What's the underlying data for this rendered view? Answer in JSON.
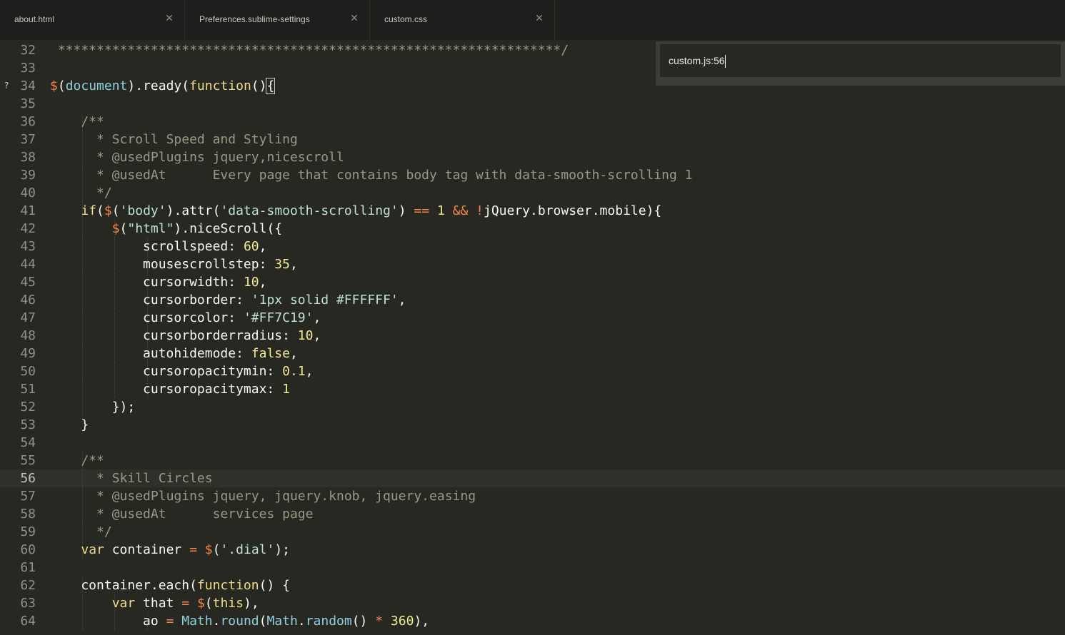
{
  "tabs": [
    {
      "label": "about.html"
    },
    {
      "label": "Preferences.sublime-settings"
    },
    {
      "label": "custom.css"
    }
  ],
  "goto": {
    "value": "custom.js:56"
  },
  "gutter_mark": "?",
  "lines": [
    {
      "n": "32",
      "guides": [],
      "tokens": [
        [
          "cm",
          " *****************************************************************/"
        ]
      ]
    },
    {
      "n": "33",
      "guides": [],
      "tokens": []
    },
    {
      "n": "34",
      "mark": true,
      "guides": [],
      "tokens": [
        [
          "dol",
          "$"
        ],
        [
          "plain",
          "("
        ],
        [
          "math",
          "document"
        ],
        [
          "plain",
          ").ready("
        ],
        [
          "kw",
          "function"
        ],
        [
          "plain",
          "()"
        ],
        [
          "brace",
          "{"
        ]
      ]
    },
    {
      "n": "35",
      "guides": [],
      "tokens": []
    },
    {
      "n": "36",
      "guides": [],
      "tokens": [
        [
          "plain",
          "    "
        ],
        [
          "cm",
          "/**"
        ]
      ]
    },
    {
      "n": "37",
      "guides": [],
      "tokens": [
        [
          "plain",
          "    "
        ],
        [
          "cm",
          "  * Scroll Speed and Styling"
        ]
      ]
    },
    {
      "n": "38",
      "guides": [],
      "tokens": [
        [
          "plain",
          "    "
        ],
        [
          "cm",
          "  * @usedPlugins jquery,nicescroll"
        ]
      ]
    },
    {
      "n": "39",
      "guides": [],
      "tokens": [
        [
          "plain",
          "    "
        ],
        [
          "cm",
          "  * @usedAt      Every page that contains body tag with data-smooth-scrolling 1"
        ]
      ]
    },
    {
      "n": "40",
      "guides": [],
      "tokens": [
        [
          "plain",
          "    "
        ],
        [
          "cm",
          "  */"
        ]
      ]
    },
    {
      "n": "41",
      "guides": [],
      "tokens": [
        [
          "plain",
          "    "
        ],
        [
          "kw",
          "if"
        ],
        [
          "plain",
          "("
        ],
        [
          "dol",
          "$"
        ],
        [
          "plain",
          "("
        ],
        [
          "str",
          "'body'"
        ],
        [
          "plain",
          ").attr("
        ],
        [
          "str",
          "'data-smooth-scrolling'"
        ],
        [
          "plain",
          ") "
        ],
        [
          "op",
          "=="
        ],
        [
          "plain",
          " "
        ],
        [
          "num",
          "1"
        ],
        [
          "plain",
          " "
        ],
        [
          "op",
          "&&"
        ],
        [
          "plain",
          " "
        ],
        [
          "op",
          "!"
        ],
        [
          "plain",
          "jQuery.browser.mobile){"
        ]
      ]
    },
    {
      "n": "42",
      "guides": [],
      "tokens": [
        [
          "plain",
          "        "
        ],
        [
          "dol",
          "$"
        ],
        [
          "plain",
          "("
        ],
        [
          "str",
          "\"html\""
        ],
        [
          "plain",
          ").niceScroll({"
        ]
      ]
    },
    {
      "n": "43",
      "guides": [],
      "tokens": [
        [
          "plain",
          "            scrollspeed: "
        ],
        [
          "num",
          "60"
        ],
        [
          "plain",
          ","
        ]
      ]
    },
    {
      "n": "44",
      "guides": [],
      "tokens": [
        [
          "plain",
          "            mousescrollstep: "
        ],
        [
          "num",
          "35"
        ],
        [
          "plain",
          ","
        ]
      ]
    },
    {
      "n": "45",
      "guides": [],
      "tokens": [
        [
          "plain",
          "            cursorwidth: "
        ],
        [
          "num",
          "10"
        ],
        [
          "plain",
          ","
        ]
      ]
    },
    {
      "n": "46",
      "guides": [],
      "tokens": [
        [
          "plain",
          "            cursorborder: "
        ],
        [
          "str",
          "'1px solid #FFFFFF'"
        ],
        [
          "plain",
          ","
        ]
      ]
    },
    {
      "n": "47",
      "guides": [],
      "tokens": [
        [
          "plain",
          "            cursorcolor: "
        ],
        [
          "str",
          "'#FF7C19'"
        ],
        [
          "plain",
          ","
        ]
      ]
    },
    {
      "n": "48",
      "guides": [],
      "tokens": [
        [
          "plain",
          "            cursorborderradius: "
        ],
        [
          "num",
          "10"
        ],
        [
          "plain",
          ","
        ]
      ]
    },
    {
      "n": "49",
      "guides": [],
      "tokens": [
        [
          "plain",
          "            autohidemode: "
        ],
        [
          "num",
          "false"
        ],
        [
          "plain",
          ","
        ]
      ]
    },
    {
      "n": "50",
      "guides": [],
      "tokens": [
        [
          "plain",
          "            cursoropacitymin: "
        ],
        [
          "num",
          "0.1"
        ],
        [
          "plain",
          ","
        ]
      ]
    },
    {
      "n": "51",
      "guides": [],
      "tokens": [
        [
          "plain",
          "            cursoropacitymax: "
        ],
        [
          "num",
          "1"
        ]
      ]
    },
    {
      "n": "52",
      "guides": [],
      "tokens": [
        [
          "plain",
          "        });"
        ]
      ]
    },
    {
      "n": "53",
      "guides": [],
      "tokens": [
        [
          "plain",
          "    }"
        ]
      ]
    },
    {
      "n": "54",
      "guides": [],
      "tokens": []
    },
    {
      "n": "55",
      "guides": [],
      "tokens": [
        [
          "plain",
          "    "
        ],
        [
          "cm",
          "/**"
        ]
      ]
    },
    {
      "n": "56",
      "current": true,
      "guides": [],
      "tokens": [
        [
          "plain",
          "    "
        ],
        [
          "cm",
          "  * Skill Circles"
        ]
      ]
    },
    {
      "n": "57",
      "guides": [],
      "tokens": [
        [
          "plain",
          "    "
        ],
        [
          "cm",
          "  * @usedPlugins jquery, jquery.knob, jquery.easing"
        ]
      ]
    },
    {
      "n": "58",
      "guides": [],
      "tokens": [
        [
          "plain",
          "    "
        ],
        [
          "cm",
          "  * @usedAt      services page"
        ]
      ]
    },
    {
      "n": "59",
      "guides": [],
      "tokens": [
        [
          "plain",
          "    "
        ],
        [
          "cm",
          "  */"
        ]
      ]
    },
    {
      "n": "60",
      "guides": [],
      "tokens": [
        [
          "plain",
          "    "
        ],
        [
          "var",
          "var"
        ],
        [
          "plain",
          " container "
        ],
        [
          "op",
          "="
        ],
        [
          "plain",
          " "
        ],
        [
          "dol",
          "$"
        ],
        [
          "plain",
          "("
        ],
        [
          "str",
          "'.dial'"
        ],
        [
          "plain",
          ");"
        ]
      ]
    },
    {
      "n": "61",
      "guides": [],
      "tokens": []
    },
    {
      "n": "62",
      "guides": [],
      "tokens": [
        [
          "plain",
          "    container.each("
        ],
        [
          "kw",
          "function"
        ],
        [
          "plain",
          "() {"
        ]
      ]
    },
    {
      "n": "63",
      "guides": [],
      "tokens": [
        [
          "plain",
          "        "
        ],
        [
          "var",
          "var"
        ],
        [
          "plain",
          " that "
        ],
        [
          "op",
          "="
        ],
        [
          "plain",
          " "
        ],
        [
          "dol",
          "$"
        ],
        [
          "plain",
          "("
        ],
        [
          "this",
          "this"
        ],
        [
          "plain",
          "),"
        ]
      ]
    },
    {
      "n": "64",
      "guides": [],
      "tokens": [
        [
          "plain",
          "            ao "
        ],
        [
          "op",
          "="
        ],
        [
          "plain",
          " "
        ],
        [
          "math",
          "Math"
        ],
        [
          "plain",
          "."
        ],
        [
          "math",
          "round"
        ],
        [
          "plain",
          "("
        ],
        [
          "math",
          "Math"
        ],
        [
          "plain",
          "."
        ],
        [
          "math",
          "random"
        ],
        [
          "plain",
          "() "
        ],
        [
          "op",
          "*"
        ],
        [
          "plain",
          " "
        ],
        [
          "num",
          "360"
        ],
        [
          "plain",
          "),"
        ]
      ]
    }
  ]
}
